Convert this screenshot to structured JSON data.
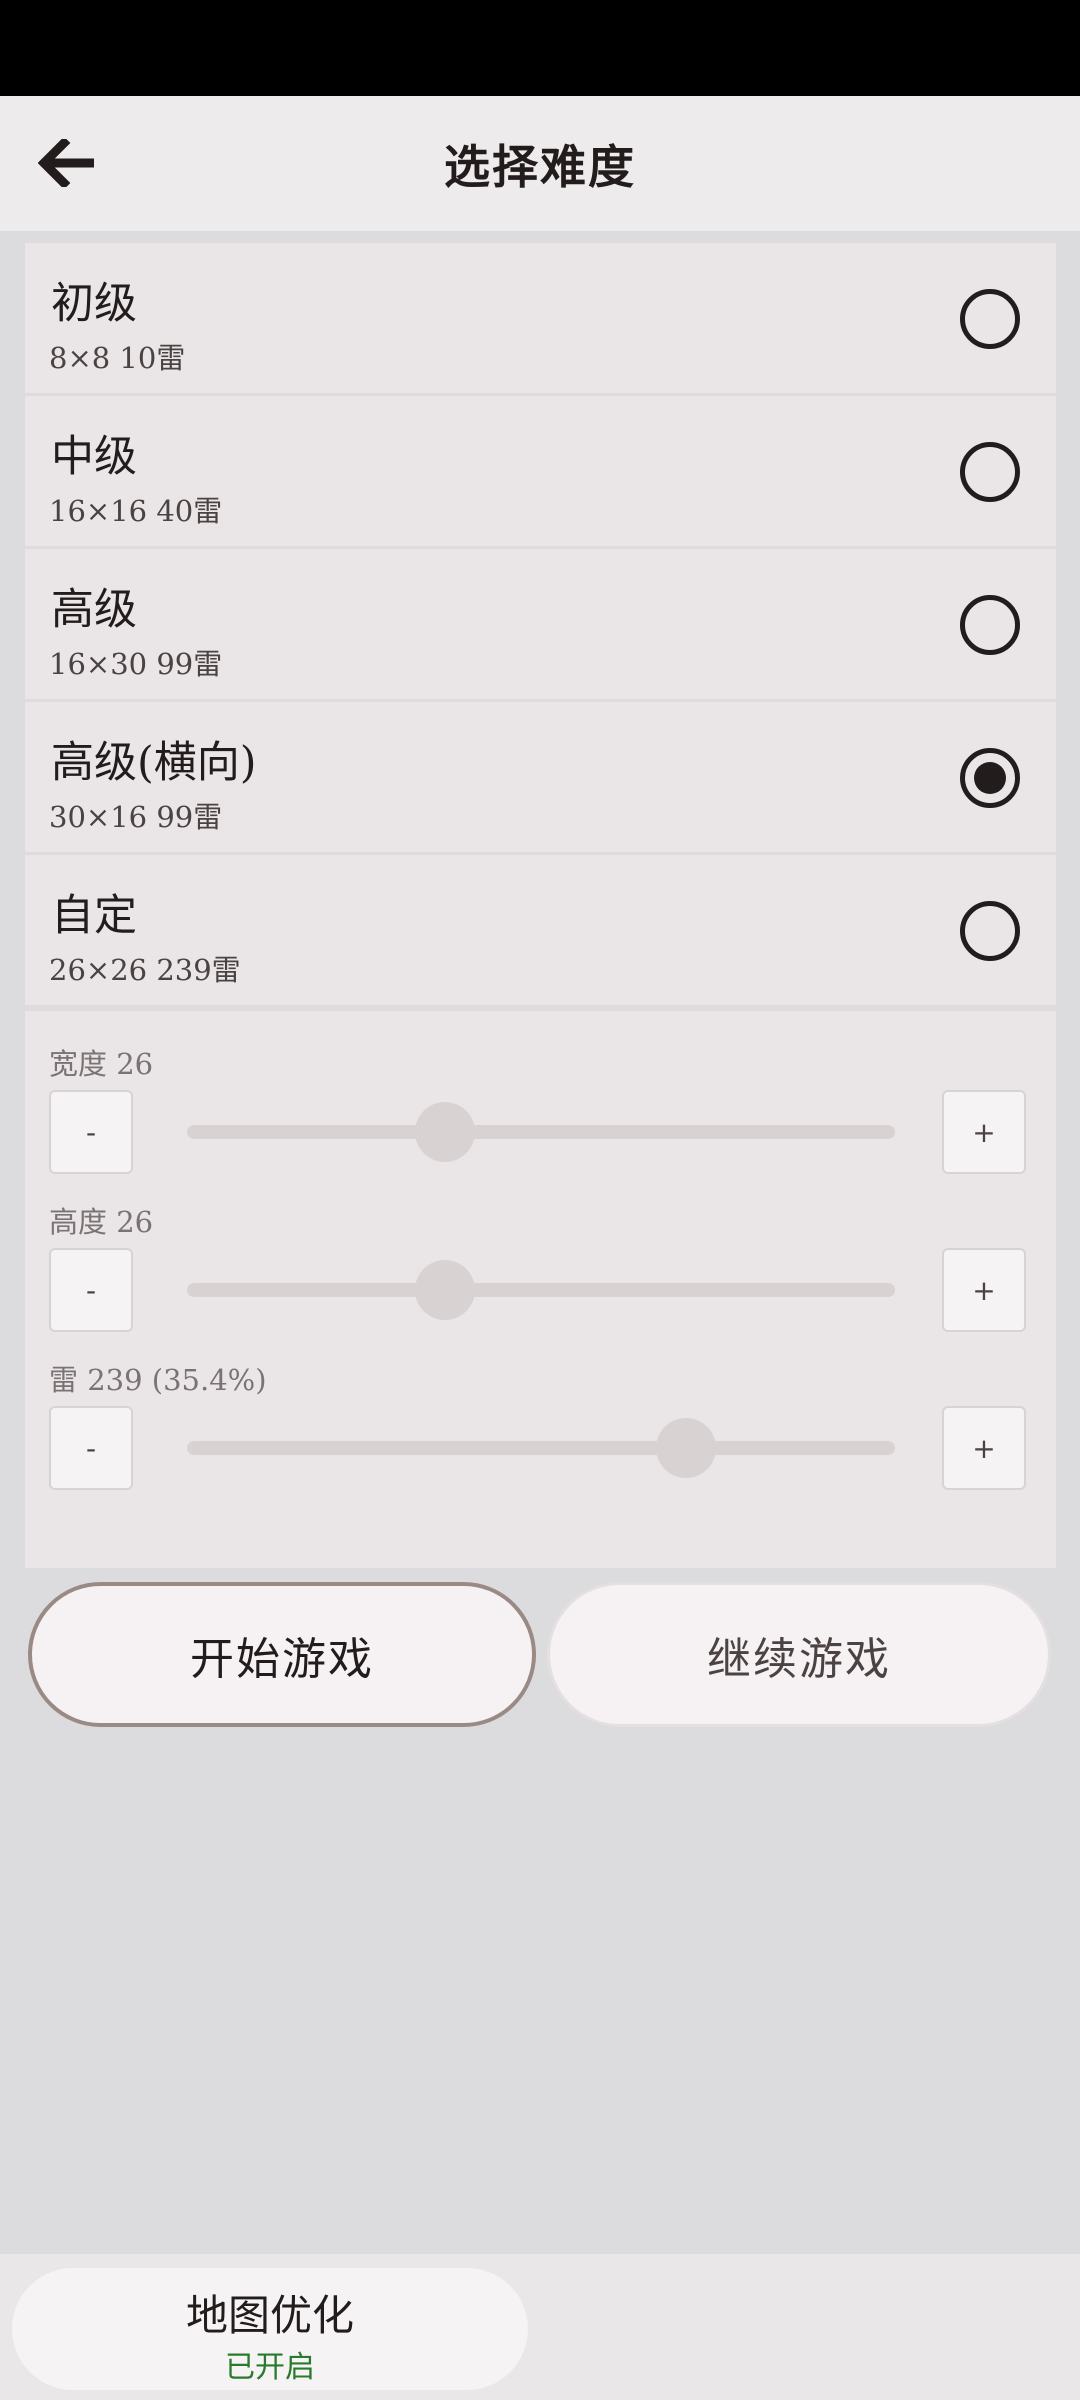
{
  "header": {
    "title": "选择难度"
  },
  "options": [
    {
      "title": "初级",
      "sub": "8×8  10雷",
      "selected": false
    },
    {
      "title": "中级",
      "sub": "16×16  40雷",
      "selected": false
    },
    {
      "title": "高级",
      "sub": "16×30  99雷",
      "selected": false
    },
    {
      "title": "高级(横向)",
      "sub": "30×16  99雷",
      "selected": true
    },
    {
      "title": "自定",
      "sub": "26×26  239雷",
      "selected": false
    }
  ],
  "custom": {
    "width": {
      "label": "宽度  26",
      "value": 26,
      "fraction": 0.365
    },
    "height": {
      "label": "高度  26",
      "value": 26,
      "fraction": 0.365
    },
    "mines": {
      "label": "雷  239 (35.4%)",
      "value": 239,
      "fraction": 0.705
    },
    "minus": "-",
    "plus": "+"
  },
  "actions": {
    "start": "开始游戏",
    "continue": "继续游戏"
  },
  "bottom": {
    "map_title": "地图优化",
    "map_status": "已开启"
  },
  "colors": {
    "accent": "#231c1c",
    "enabled_status": "#2a7a2e",
    "slider": "#d9d2d3"
  },
  "icons": {
    "back": "arrow-left-icon"
  }
}
